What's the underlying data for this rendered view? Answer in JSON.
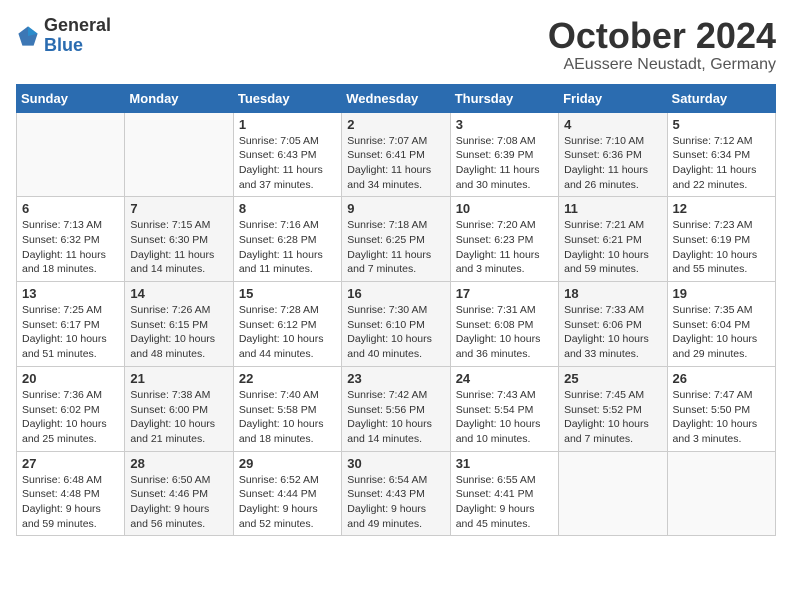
{
  "header": {
    "logo_general": "General",
    "logo_blue": "Blue",
    "month_title": "October 2024",
    "location": "AEussere Neustadt, Germany"
  },
  "days_of_week": [
    "Sunday",
    "Monday",
    "Tuesday",
    "Wednesday",
    "Thursday",
    "Friday",
    "Saturday"
  ],
  "weeks": [
    [
      {
        "day": "",
        "info": ""
      },
      {
        "day": "",
        "info": ""
      },
      {
        "day": "1",
        "info": "Sunrise: 7:05 AM\nSunset: 6:43 PM\nDaylight: 11 hours and 37 minutes."
      },
      {
        "day": "2",
        "info": "Sunrise: 7:07 AM\nSunset: 6:41 PM\nDaylight: 11 hours and 34 minutes."
      },
      {
        "day": "3",
        "info": "Sunrise: 7:08 AM\nSunset: 6:39 PM\nDaylight: 11 hours and 30 minutes."
      },
      {
        "day": "4",
        "info": "Sunrise: 7:10 AM\nSunset: 6:36 PM\nDaylight: 11 hours and 26 minutes."
      },
      {
        "day": "5",
        "info": "Sunrise: 7:12 AM\nSunset: 6:34 PM\nDaylight: 11 hours and 22 minutes."
      }
    ],
    [
      {
        "day": "6",
        "info": "Sunrise: 7:13 AM\nSunset: 6:32 PM\nDaylight: 11 hours and 18 minutes."
      },
      {
        "day": "7",
        "info": "Sunrise: 7:15 AM\nSunset: 6:30 PM\nDaylight: 11 hours and 14 minutes."
      },
      {
        "day": "8",
        "info": "Sunrise: 7:16 AM\nSunset: 6:28 PM\nDaylight: 11 hours and 11 minutes."
      },
      {
        "day": "9",
        "info": "Sunrise: 7:18 AM\nSunset: 6:25 PM\nDaylight: 11 hours and 7 minutes."
      },
      {
        "day": "10",
        "info": "Sunrise: 7:20 AM\nSunset: 6:23 PM\nDaylight: 11 hours and 3 minutes."
      },
      {
        "day": "11",
        "info": "Sunrise: 7:21 AM\nSunset: 6:21 PM\nDaylight: 10 hours and 59 minutes."
      },
      {
        "day": "12",
        "info": "Sunrise: 7:23 AM\nSunset: 6:19 PM\nDaylight: 10 hours and 55 minutes."
      }
    ],
    [
      {
        "day": "13",
        "info": "Sunrise: 7:25 AM\nSunset: 6:17 PM\nDaylight: 10 hours and 51 minutes."
      },
      {
        "day": "14",
        "info": "Sunrise: 7:26 AM\nSunset: 6:15 PM\nDaylight: 10 hours and 48 minutes."
      },
      {
        "day": "15",
        "info": "Sunrise: 7:28 AM\nSunset: 6:12 PM\nDaylight: 10 hours and 44 minutes."
      },
      {
        "day": "16",
        "info": "Sunrise: 7:30 AM\nSunset: 6:10 PM\nDaylight: 10 hours and 40 minutes."
      },
      {
        "day": "17",
        "info": "Sunrise: 7:31 AM\nSunset: 6:08 PM\nDaylight: 10 hours and 36 minutes."
      },
      {
        "day": "18",
        "info": "Sunrise: 7:33 AM\nSunset: 6:06 PM\nDaylight: 10 hours and 33 minutes."
      },
      {
        "day": "19",
        "info": "Sunrise: 7:35 AM\nSunset: 6:04 PM\nDaylight: 10 hours and 29 minutes."
      }
    ],
    [
      {
        "day": "20",
        "info": "Sunrise: 7:36 AM\nSunset: 6:02 PM\nDaylight: 10 hours and 25 minutes."
      },
      {
        "day": "21",
        "info": "Sunrise: 7:38 AM\nSunset: 6:00 PM\nDaylight: 10 hours and 21 minutes."
      },
      {
        "day": "22",
        "info": "Sunrise: 7:40 AM\nSunset: 5:58 PM\nDaylight: 10 hours and 18 minutes."
      },
      {
        "day": "23",
        "info": "Sunrise: 7:42 AM\nSunset: 5:56 PM\nDaylight: 10 hours and 14 minutes."
      },
      {
        "day": "24",
        "info": "Sunrise: 7:43 AM\nSunset: 5:54 PM\nDaylight: 10 hours and 10 minutes."
      },
      {
        "day": "25",
        "info": "Sunrise: 7:45 AM\nSunset: 5:52 PM\nDaylight: 10 hours and 7 minutes."
      },
      {
        "day": "26",
        "info": "Sunrise: 7:47 AM\nSunset: 5:50 PM\nDaylight: 10 hours and 3 minutes."
      }
    ],
    [
      {
        "day": "27",
        "info": "Sunrise: 6:48 AM\nSunset: 4:48 PM\nDaylight: 9 hours and 59 minutes."
      },
      {
        "day": "28",
        "info": "Sunrise: 6:50 AM\nSunset: 4:46 PM\nDaylight: 9 hours and 56 minutes."
      },
      {
        "day": "29",
        "info": "Sunrise: 6:52 AM\nSunset: 4:44 PM\nDaylight: 9 hours and 52 minutes."
      },
      {
        "day": "30",
        "info": "Sunrise: 6:54 AM\nSunset: 4:43 PM\nDaylight: 9 hours and 49 minutes."
      },
      {
        "day": "31",
        "info": "Sunrise: 6:55 AM\nSunset: 4:41 PM\nDaylight: 9 hours and 45 minutes."
      },
      {
        "day": "",
        "info": ""
      },
      {
        "day": "",
        "info": ""
      }
    ]
  ]
}
